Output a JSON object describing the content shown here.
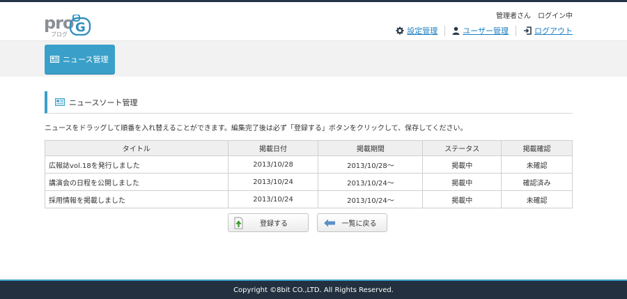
{
  "header": {
    "logo": {
      "brand": "pro",
      "sub": "ブログ",
      "letter": "G"
    },
    "login_status": "管理者さん　ログイン中",
    "nav": [
      {
        "label": "設定管理",
        "icon": "gear-icon"
      },
      {
        "label": "ユーザー管理",
        "icon": "user-icon"
      },
      {
        "label": "ログアウト",
        "icon": "logout-icon"
      }
    ]
  },
  "news_tab": {
    "label": "ニュース管理",
    "icon": "news-icon"
  },
  "section": {
    "title": "ニュースソート管理",
    "icon": "news-icon"
  },
  "description": "ニュースをドラッグして順番を入れ替えることができます。編集完了後は必ず「登録する」ボタンをクリックして、保存してください。",
  "table": {
    "headers": [
      "タイトル",
      "掲載日付",
      "掲載期間",
      "ステータス",
      "掲載確認"
    ],
    "rows": [
      [
        "広報誌vol.18を発行しました",
        "2013/10/28",
        "2013/10/28～",
        "掲載中",
        "未確認"
      ],
      [
        "講演会の日程を公開しました",
        "2013/10/24",
        "2013/10/24～",
        "掲載中",
        "確認済み"
      ],
      [
        "採用情報を掲載しました",
        "2013/10/24",
        "2013/10/24～",
        "掲載中",
        "未確認"
      ]
    ]
  },
  "buttons": {
    "register": {
      "label": "登録する",
      "icon": "upload-icon"
    },
    "back": {
      "label": "一覧に戻る",
      "icon": "arrow-left-icon"
    }
  },
  "footer": {
    "copyright": "Copyright ©8bit CO.,LTD. All Rights Reserved."
  },
  "colors": {
    "accent": "#3aa0c9",
    "footer": "#22303f",
    "link": "#1a7fc1"
  }
}
